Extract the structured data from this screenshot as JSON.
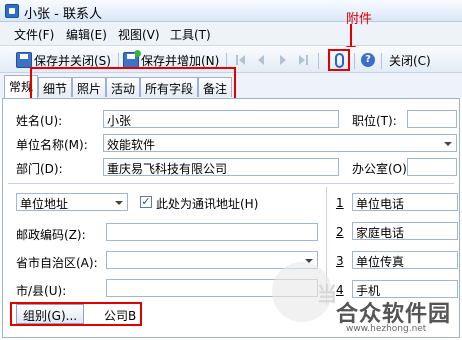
{
  "window": {
    "title": "小张 - 联系人"
  },
  "menu": [
    "文件(F)",
    "编辑(E)",
    "视图(V)",
    "工具(T)"
  ],
  "annotation": {
    "label": "附件"
  },
  "toolbar": {
    "save_close": "保存并关闭(S)",
    "save_add": "保存并增加(N)",
    "close": "关闭(C)",
    "help": "?"
  },
  "tabs": [
    "常规",
    "细节",
    "照片",
    "活动",
    "所有字段",
    "备注"
  ],
  "form": {
    "name_label": "姓名(U):",
    "name_value": "小张",
    "position_label": "职位(T):",
    "company_label": "单位名称(M):",
    "company_value": "效能软件",
    "dept_label": "部门(D):",
    "dept_value": "重庆易飞科技有限公司",
    "office_label": "办公室(O):",
    "address_type": "单位地址",
    "mail_checkbox_label": "此处为通讯地址(H)",
    "mail_checked": true,
    "postal_label": "邮政编码(Z):",
    "province_label": "省市自治区(A):",
    "city_label": "市/县(U):",
    "group_button": "组别(G)...",
    "group_value": "公司B"
  },
  "phones": [
    {
      "num": "1",
      "label": "单位电话"
    },
    {
      "num": "2",
      "label": "家庭电话"
    },
    {
      "num": "3",
      "label": "单位传真"
    },
    {
      "num": "4",
      "label": "手机"
    }
  ],
  "watermark": {
    "side_text": "当",
    "main": "合众软件园",
    "url": "www.hezhong.net"
  },
  "colors": {
    "annotation": "#e00000",
    "accent": "#2a62c0"
  }
}
